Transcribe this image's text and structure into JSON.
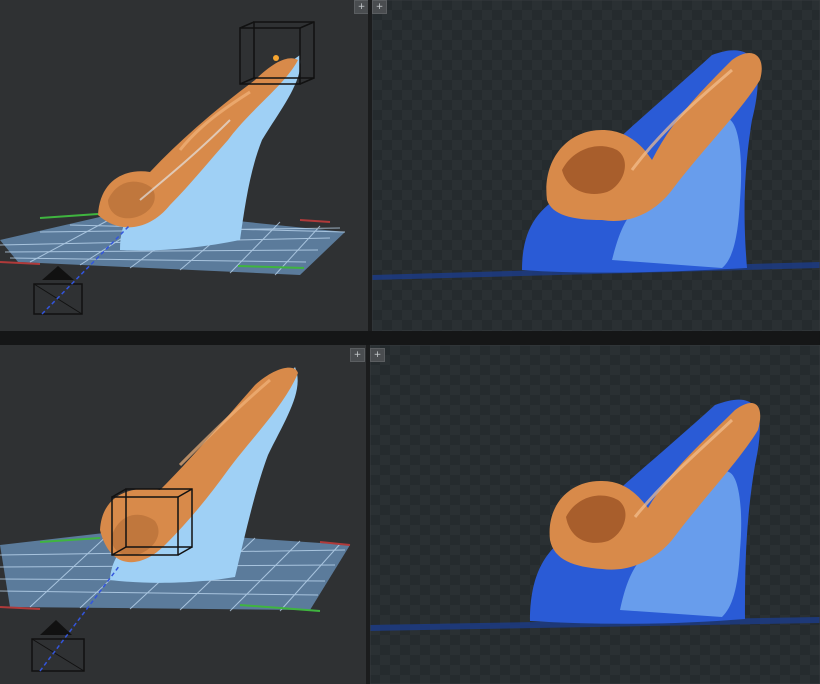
{
  "viewports": [
    {
      "id": "viewport-top-left",
      "kind": "3d-editor",
      "gizmo": "emitter-box-top"
    },
    {
      "id": "viewport-top-right",
      "kind": "render-preview"
    },
    {
      "id": "viewport-bottom-left",
      "kind": "3d-editor",
      "gizmo": "emitter-box-center"
    },
    {
      "id": "viewport-bottom-right",
      "kind": "render-preview"
    }
  ],
  "viewport_buttons": {
    "top_right_viewport": "+",
    "bottom_left_viewport": "+",
    "bottom_right_viewport": "+"
  },
  "colors": {
    "editor_bg": "#2f3133",
    "render_bg": "#242a2d",
    "grid": "#7fb8f0",
    "fluid_orange": "#d88a4a",
    "fluid_blue_editor": "#9fd0f5",
    "fluid_blue_render": "#2a5bd6",
    "axis_green": "#3fb53f",
    "axis_red": "#b03a3a"
  },
  "icons": [
    "camera-icon",
    "expand-icon",
    "emitter-box-icon"
  ]
}
